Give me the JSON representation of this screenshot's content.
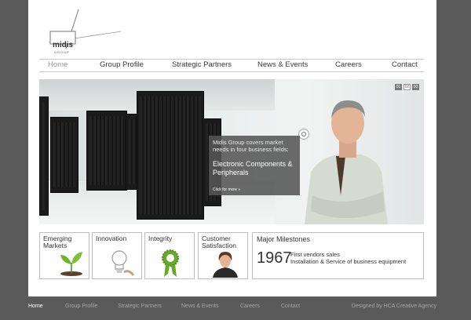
{
  "brand": {
    "logo_text": "midis",
    "logo_sub": "GROUP"
  },
  "nav": {
    "items": [
      {
        "label": "Home",
        "active": true
      },
      {
        "label": "Group Profile"
      },
      {
        "label": "Strategic Partners"
      },
      {
        "label": "News & Events"
      },
      {
        "label": "Careers"
      },
      {
        "label": "Contact"
      }
    ]
  },
  "banner": {
    "pager": [
      "01",
      "02",
      "03"
    ],
    "active_page": "02",
    "caption": {
      "intro": "Midis Group covers market needs in four business fields:",
      "title": "Electronic Components & Peripherals",
      "more": "Click for more »"
    }
  },
  "features": [
    {
      "title": "Emerging Markets",
      "icon": "plant-sprout-icon"
    },
    {
      "title": "Innovation",
      "icon": "light-bulb-icon"
    },
    {
      "title": "Integrity",
      "icon": "rosette-ribbon-icon"
    },
    {
      "title": "Customer Satisfaction",
      "icon": "customer-agent-icon"
    }
  ],
  "milestones": {
    "title": "Major Milestones",
    "year": "1967",
    "lines": [
      "First vendors sales",
      "Installation & Service of business equipment"
    ]
  },
  "footer": {
    "items": [
      {
        "label": "Home",
        "active": true
      },
      {
        "label": "Group Profile"
      },
      {
        "label": "Strategic Partners"
      },
      {
        "label": "News & Events"
      },
      {
        "label": "Careers"
      },
      {
        "label": "Contact"
      }
    ],
    "credit": "Designed by HCA Creative Agency"
  },
  "colors": {
    "background": "#5a5a5a",
    "page": "#ffffff",
    "caption_bg": "#555555",
    "accent_green": "#6aa82a"
  }
}
